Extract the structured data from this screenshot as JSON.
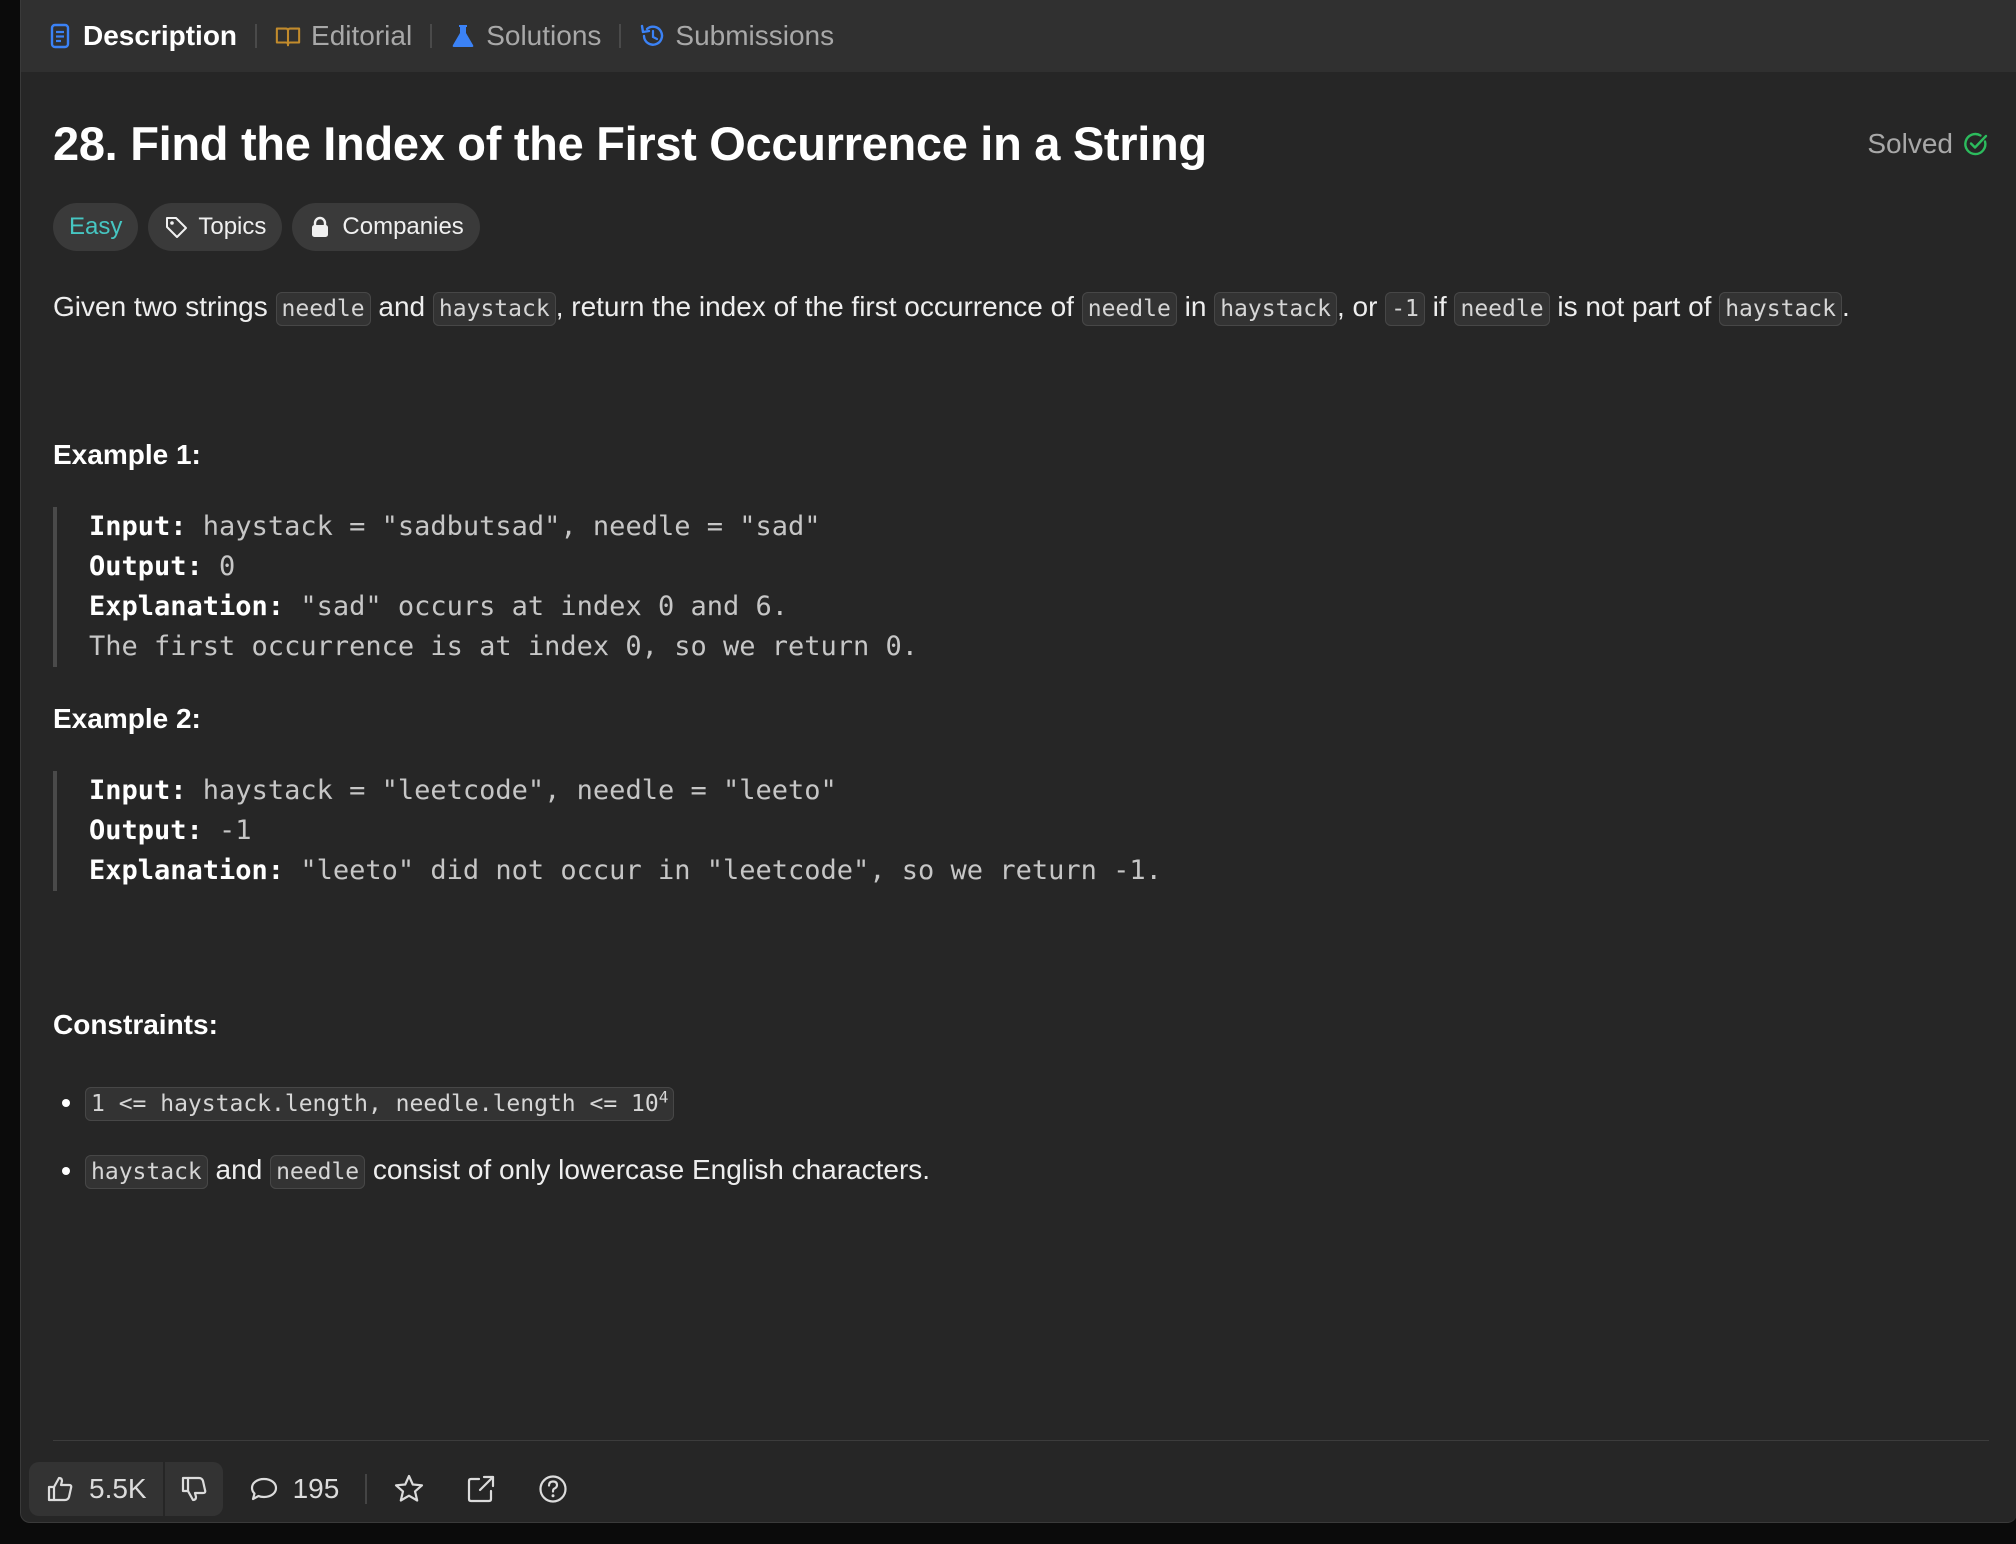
{
  "tabs": [
    {
      "label": "Description",
      "icon": "document-icon",
      "color": "#3b82f6"
    },
    {
      "label": "Editorial",
      "icon": "book-icon",
      "color": "#c28b2c"
    },
    {
      "label": "Solutions",
      "icon": "flask-icon",
      "color": "#3b82f6"
    },
    {
      "label": "Submissions",
      "icon": "history-icon",
      "color": "#3b82f6"
    }
  ],
  "problem": {
    "title": "28. Find the Index of the First Occurrence in a String",
    "status": "Solved",
    "difficulty": "Easy",
    "topics_label": "Topics",
    "companies_label": "Companies"
  },
  "description": {
    "t1": "Given two strings ",
    "c1": "needle",
    "t2": " and ",
    "c2": "haystack",
    "t3": ", return the index of the first occurrence of ",
    "c3": "needle",
    "t4": " in ",
    "c4": "haystack",
    "t5": ", or ",
    "c5": "-1",
    "t6": " if ",
    "c6": "needle",
    "t7": " is not part of ",
    "c7": "haystack",
    "t8": "."
  },
  "examples": [
    {
      "heading": "Example 1:",
      "input_label": "Input:",
      "input": " haystack = \"sadbutsad\", needle = \"sad\"",
      "output_label": "Output:",
      "output": " 0",
      "explanation_label": "Explanation:",
      "explanation": " \"sad\" occurs at index 0 and 6.",
      "explanation2": "The first occurrence is at index 0, so we return 0."
    },
    {
      "heading": "Example 2:",
      "input_label": "Input:",
      "input": " haystack = \"leetcode\", needle = \"leeto\"",
      "output_label": "Output:",
      "output": " -1",
      "explanation_label": "Explanation:",
      "explanation": " \"leeto\" did not occur in \"leetcode\", so we return -1."
    }
  ],
  "constraints": {
    "heading": "Constraints:",
    "c1_code": "1 <= haystack.length, needle.length <= 10",
    "c1_sup": "4",
    "c2_code_a": "haystack",
    "c2_text_a": " and ",
    "c2_code_b": "needle",
    "c2_text_b": " consist of only lowercase English characters."
  },
  "footer": {
    "likes": "5.5K",
    "comments": "195"
  },
  "colors": {
    "easy": "#46c6c2",
    "solved_check": "#2cbb5d",
    "panel_bg": "#262626",
    "tabbar_bg": "#303030"
  }
}
